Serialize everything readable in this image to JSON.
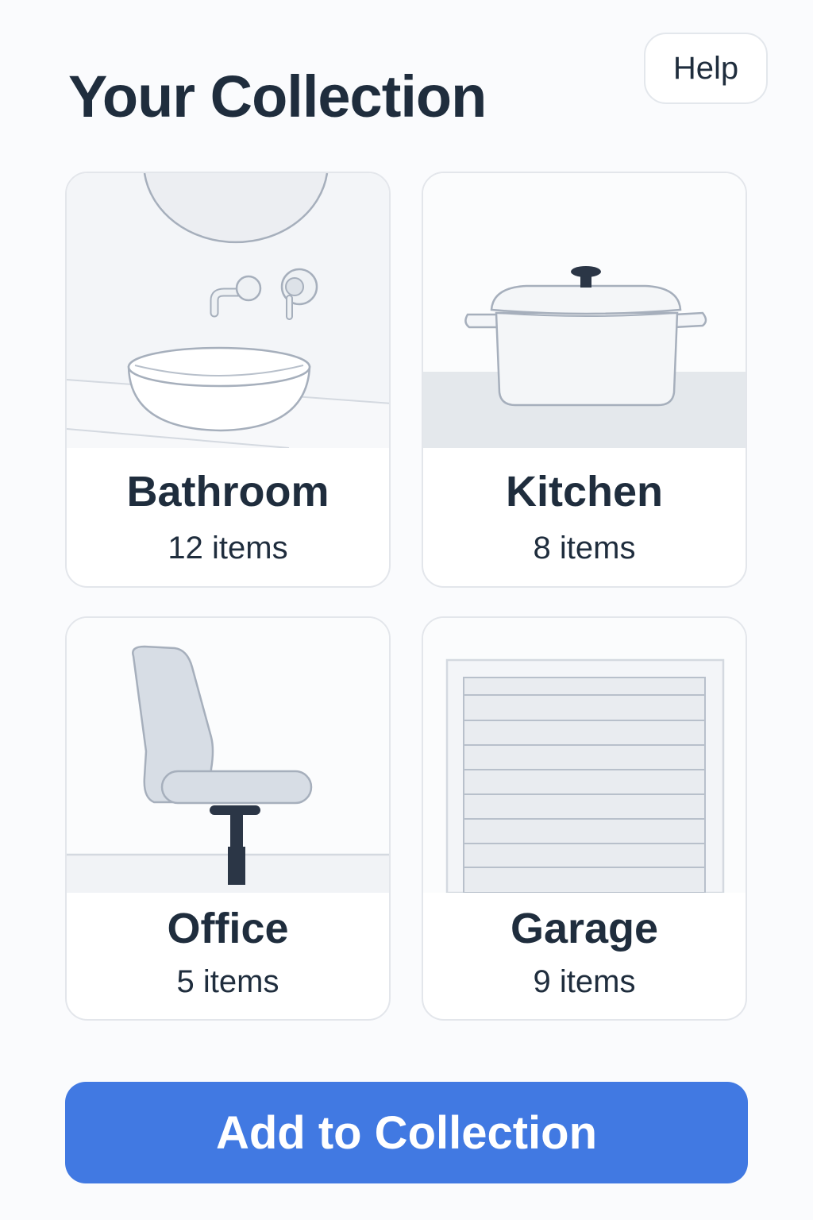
{
  "header": {
    "title": "Your Collection",
    "help_label": "Help"
  },
  "categories": [
    {
      "name": "Bathroom",
      "count": "12 items",
      "icon": "sink-icon"
    },
    {
      "name": "Kitchen",
      "count": "8 items",
      "icon": "pot-icon"
    },
    {
      "name": "Office",
      "count": "5 items",
      "icon": "chair-icon"
    },
    {
      "name": "Garage",
      "count": "9 items",
      "icon": "garage-door-icon"
    }
  ],
  "actions": {
    "add_label": "Add to Collection"
  },
  "colors": {
    "accent": "#4179e2",
    "text": "#1f2d3d",
    "background": "#fafbfd",
    "card_border": "#e3e6eb"
  }
}
